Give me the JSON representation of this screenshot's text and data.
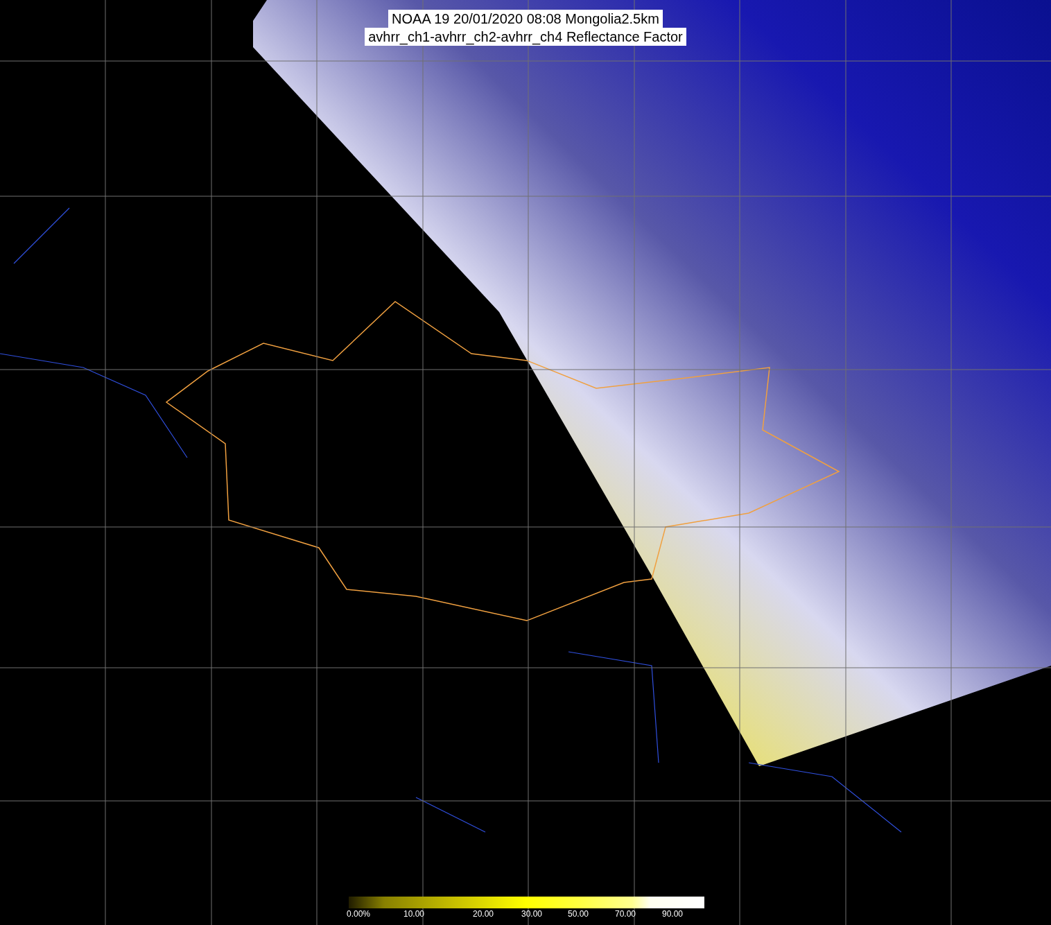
{
  "title": {
    "lines": [
      "NOAA 19 20/01/2020 08:08 Mongolia2.5km",
      "avhrr_ch1-avhrr_ch2-avhrr_ch4 Reflectance Factor"
    ]
  },
  "colorbar": {
    "labels": [
      "0.00%",
      "10.00",
      "20.00",
      "30.00",
      "50.00",
      "70.00",
      "90.00"
    ]
  }
}
